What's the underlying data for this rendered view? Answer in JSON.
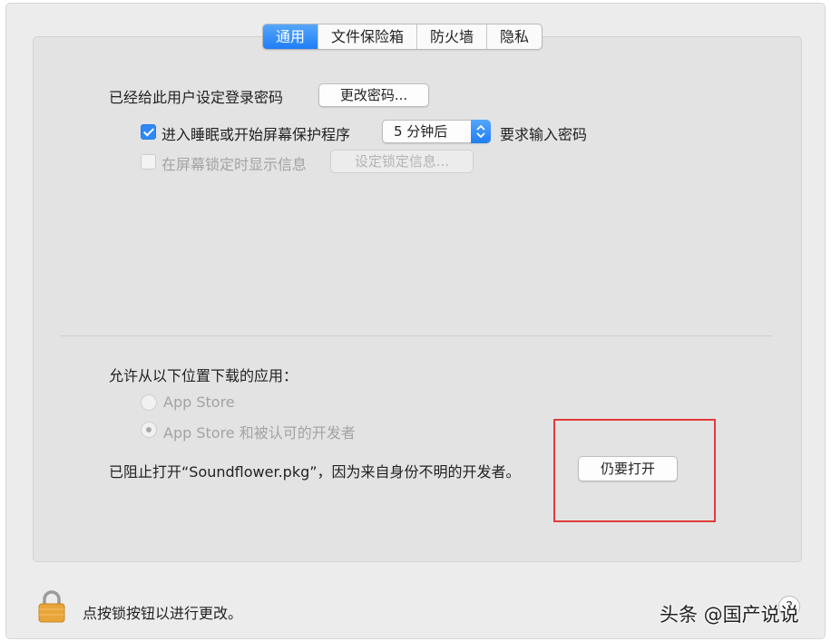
{
  "tabs": [
    {
      "label": "通用",
      "active": true
    },
    {
      "label": "文件保险箱",
      "active": false
    },
    {
      "label": "防火墙",
      "active": false
    },
    {
      "label": "隐私",
      "active": false
    }
  ],
  "general": {
    "password_label": "已经给此用户设定登录密码",
    "change_password_button": "更改密码...",
    "sleep_check_label": "进入睡眠或开始屏幕保护程序",
    "sleep_check_checked": true,
    "delay_select_value": "5 分钟后",
    "require_password_label": "要求输入密码",
    "lock_message_label": "在屏幕锁定时显示信息",
    "lock_message_checked": false,
    "set_lock_message_button": "设定锁定信息..."
  },
  "downloads": {
    "heading": "允许从以下位置下载的应用：",
    "options": [
      {
        "label": "App Store",
        "selected": false
      },
      {
        "label": "App Store 和被认可的开发者",
        "selected": true
      }
    ],
    "blocked_message": "已阻止打开“Soundflower.pkg”，因为来自身份不明的开发者。",
    "open_anyway_button": "仍要打开"
  },
  "footer": {
    "lock_text": "点按锁按钮以进行更改。",
    "help_label": "?"
  },
  "watermark": "头条 @国产说说",
  "colors": {
    "accent": "#1f7ef6",
    "highlight_box": "#e33a3a",
    "lock": "#e8a53a"
  },
  "icons": {
    "lock": "lock-icon",
    "stepper": "up-down-arrows-icon"
  }
}
